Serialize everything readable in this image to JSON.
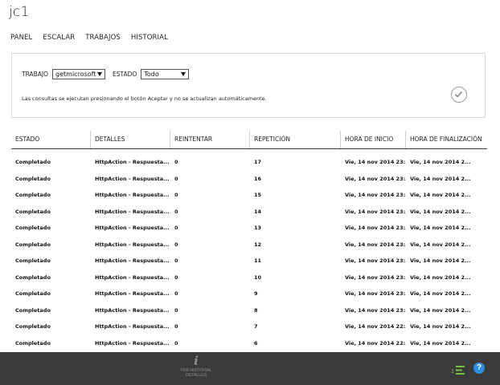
{
  "app": {
    "title": "jc1"
  },
  "nav": [
    {
      "label": "PANEL"
    },
    {
      "label": "ESCALAR"
    },
    {
      "label": "TRABAJOS"
    },
    {
      "label": "HISTORIAL"
    }
  ],
  "filters": {
    "job_label": "TRABAJO",
    "job_value": "getmicrosoft",
    "state_label": "ESTADO",
    "state_value": "Todo",
    "note": "Las consultas se ejecutan presionando el botón Aceptar y no se actualizan automáticamente.",
    "accept_icon": "check-circle-icon"
  },
  "table": {
    "headers": [
      "ESTADO",
      "DETALLES",
      "REINTENTAR",
      "REPETICIÓN",
      "HORA DE INICIO",
      "HORA DE FINALIZACIÓN"
    ],
    "rows": [
      [
        "Completado",
        "HttpAction - Respuesta...",
        "0",
        "17",
        "Vie, 14 nov 2014 23:...",
        "Vie, 14 nov 2014 2..."
      ],
      [
        "Completado",
        "HttpAction - Respuesta...",
        "0",
        "16",
        "Vie, 14 nov 2014 23:...",
        "Vie, 14 nov 2014 2..."
      ],
      [
        "Completado",
        "HttpAction - Respuesta...",
        "0",
        "15",
        "Vie, 14 nov 2014 23:...",
        "Vie, 14 nov 2014 2..."
      ],
      [
        "Completado",
        "HttpAction - Respuesta...",
        "0",
        "14",
        "Vie, 14 nov 2014 23:...",
        "Vie, 14 nov 2014 2..."
      ],
      [
        "Completado",
        "HttpAction - Respuesta...",
        "0",
        "13",
        "Vie, 14 nov 2014 23:...",
        "Vie, 14 nov 2014 2..."
      ],
      [
        "Completado",
        "HttpAction - Respuesta...",
        "0",
        "12",
        "Vie, 14 nov 2014 23:...",
        "Vie, 14 nov 2014 2..."
      ],
      [
        "Completado",
        "HttpAction - Respuesta...",
        "0",
        "11",
        "Vie, 14 nov 2014 23:...",
        "Vie, 14 nov 2014 2..."
      ],
      [
        "Completado",
        "HttpAction - Respuesta...",
        "0",
        "10",
        "Vie, 14 nov 2014 23:...",
        "Vie, 14 nov 2014 2..."
      ],
      [
        "Completado",
        "HttpAction - Respuesta...",
        "0",
        "9",
        "Vie, 14 nov 2014 23:...",
        "Vie, 14 nov 2014 2..."
      ],
      [
        "Completado",
        "HttpAction - Respuesta...",
        "0",
        "8",
        "Vie, 14 nov 2014 23:...",
        "Vie, 14 nov 2014 2..."
      ],
      [
        "Completado",
        "HttpAction - Respuesta...",
        "0",
        "7",
        "Vie, 14 nov 2014 22:...",
        "Vie, 14 nov 2014 2..."
      ],
      [
        "Completado",
        "HttpAction - Respuesta...",
        "0",
        "6",
        "Vie, 14 nov 2014 22:...",
        "Vie, 14 nov 2014 2..."
      ]
    ]
  },
  "bottom_bar": {
    "details_line1": "VER HISTORIAL",
    "details_line2": "DETALLES",
    "info_icon": "info-icon",
    "queue_badge": "1",
    "help_label": "?"
  },
  "colors": {
    "bottom_bar": "#3b3b3b",
    "queue_accent": "#7ac142",
    "help_blue": "#2d8fe0"
  }
}
